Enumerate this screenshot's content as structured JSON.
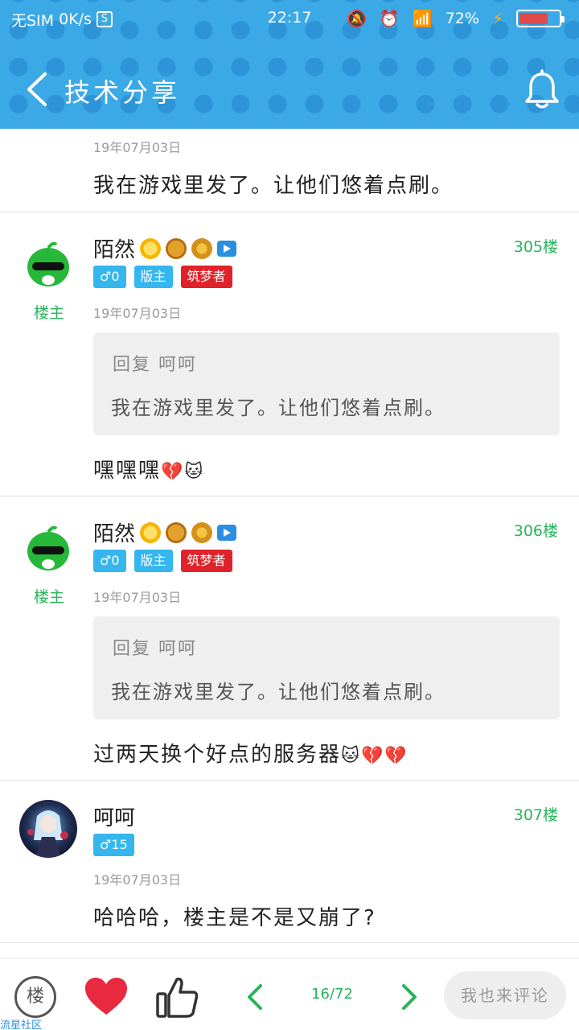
{
  "status_bar": {
    "carrier": "无SIM",
    "speed": "0K/s",
    "sim_icon": "S",
    "time": "22:17",
    "battery": "72%",
    "battery_level": 0.72
  },
  "header": {
    "title": "技术分享"
  },
  "top_fragment": {
    "date": "19年07月03日",
    "text": "我在游戏里发了。让他们悠着点刷。"
  },
  "posts": [
    {
      "username": "陌然",
      "floor": "305楼",
      "role_label": "楼主",
      "gender_tag": "♂0",
      "mod_tag": "版主",
      "dream_tag": "筑梦者",
      "date": "19年07月03日",
      "quote_head": "回复 呵呵",
      "quote_text": "我在游戏里发了。让他们悠着点刷。",
      "text": "嘿嘿嘿",
      "emojis": "💔🐱"
    },
    {
      "username": "陌然",
      "floor": "306楼",
      "role_label": "楼主",
      "gender_tag": "♂0",
      "mod_tag": "版主",
      "dream_tag": "筑梦者",
      "date": "19年07月03日",
      "quote_head": "回复 呵呵",
      "quote_text": "我在游戏里发了。让他们悠着点刷。",
      "text": "过两天换个好点的服务器",
      "emojis": "🐱💔💔"
    },
    {
      "username": "呵呵",
      "floor": "307楼",
      "gender_tag": "♂15",
      "date": "19年07月03日",
      "text": "哈哈哈，楼主是不是又崩了?"
    }
  ],
  "bottom_bar": {
    "floor_button": "楼",
    "watermark": "流星社区",
    "page": "16/72",
    "comment_button": "我也来评论"
  },
  "colors": {
    "header_bg": "#3aa9e6",
    "accent_green": "#29b45a",
    "tag_blue": "#35b6ee",
    "tag_red": "#e0232a",
    "heart_red": "#e8293f"
  }
}
